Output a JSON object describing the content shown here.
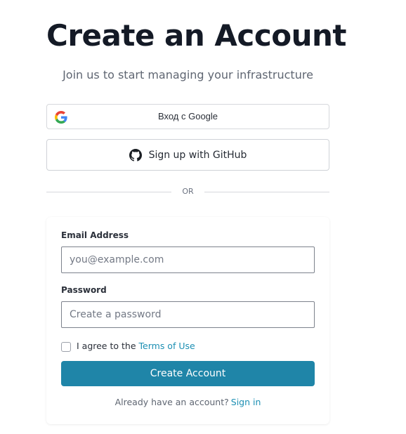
{
  "header": {
    "title": "Create an Account",
    "subtitle": "Join us to start managing your infrastructure"
  },
  "oauth": {
    "google_label": "Вход с Google",
    "github_label": "Sign up with GitHub"
  },
  "divider": {
    "label": "OR"
  },
  "form": {
    "email_label": "Email Address",
    "email_placeholder": "you@example.com",
    "email_value": "",
    "password_label": "Password",
    "password_placeholder": "Create a password",
    "password_value": "",
    "agree_checked": false,
    "agree_text": "I agree to the",
    "terms_link": "Terms of Use",
    "submit_label": "Create Account",
    "have_account_text": "Already have an account?",
    "signin_link": "Sign in"
  },
  "icons": {
    "google": "google-g-logo",
    "github": "github-octocat-logo"
  },
  "colors": {
    "accent": "#1f85a8",
    "link": "#1c8fb3",
    "title": "#141a26"
  }
}
